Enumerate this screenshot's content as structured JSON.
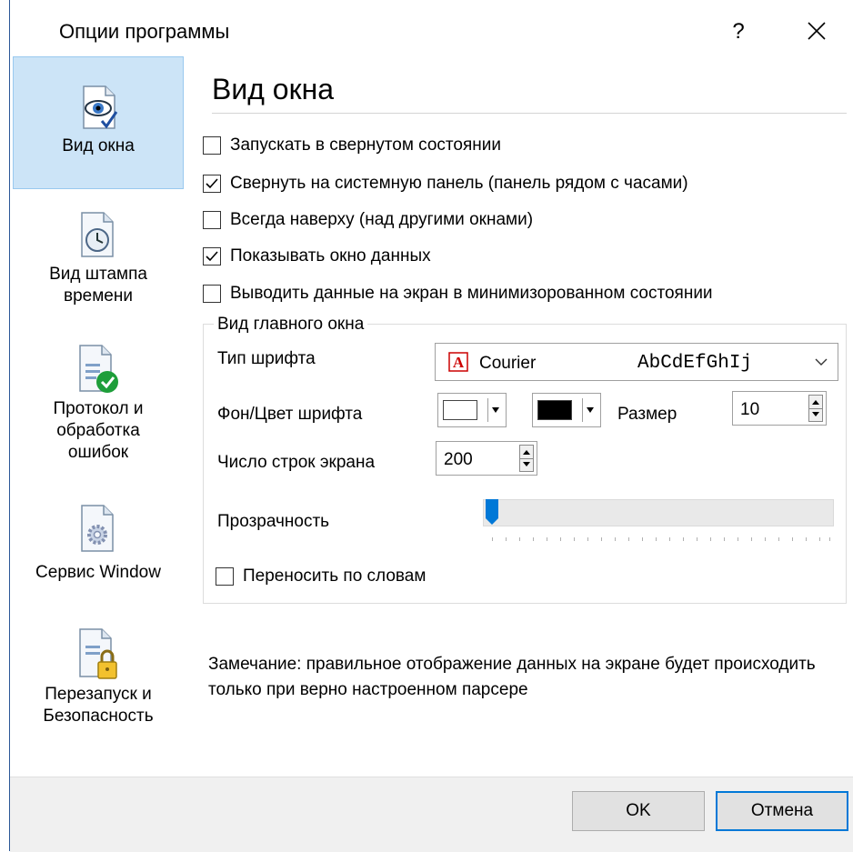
{
  "dialog": {
    "title": "Опции программы",
    "help_label": "?"
  },
  "sidebar": {
    "items": [
      {
        "label": "Вид окна",
        "icon": "eye-document-icon",
        "active": true
      },
      {
        "label": "Вид штампа времени",
        "icon": "clock-document-icon"
      },
      {
        "label": "Протокол и обработка ошибок",
        "icon": "checkmark-document-icon"
      },
      {
        "label": "Сервис Window",
        "icon": "gear-document-icon"
      },
      {
        "label": "Перезапуск и Безопасность",
        "icon": "lock-document-icon"
      }
    ]
  },
  "page": {
    "heading": "Вид окна"
  },
  "options": [
    {
      "label": "Запускать в свернутом состоянии",
      "checked": false
    },
    {
      "label": "Свернуть на системную панель (панель рядом с часами)",
      "checked": true
    },
    {
      "label": "Всегда наверху (над другими окнами)",
      "checked": false
    },
    {
      "label": "Показывать окно данных",
      "checked": true
    },
    {
      "label": "Выводить данные на экран в минимизорованном состоянии",
      "checked": false
    }
  ],
  "main_window": {
    "legend": "Вид главного окна",
    "font_type_label": "Тип шрифта",
    "font_name": "Courier",
    "font_sample": "AbCdEfGhIj",
    "color_label": "Фон/Цвет шрифта",
    "bg_color": "#ffffff",
    "fg_color": "#000000",
    "size_label": "Размер",
    "size_value": "10",
    "lines_label": "Число строк экрана",
    "lines_value": "200",
    "transparency_label": "Прозрачность",
    "transparency_value": 0,
    "word_wrap_label": "Переносить по словам",
    "word_wrap_checked": false
  },
  "note": "Замечание: правильное отображение данных на экране будет происходить только при верно настроенном парсере",
  "buttons": {
    "ok": "OK",
    "cancel": "Отмена"
  },
  "colors": {
    "accent": "#0078d7",
    "selected_bg": "#cce4f7",
    "font_icon_red": "#cc0000"
  }
}
